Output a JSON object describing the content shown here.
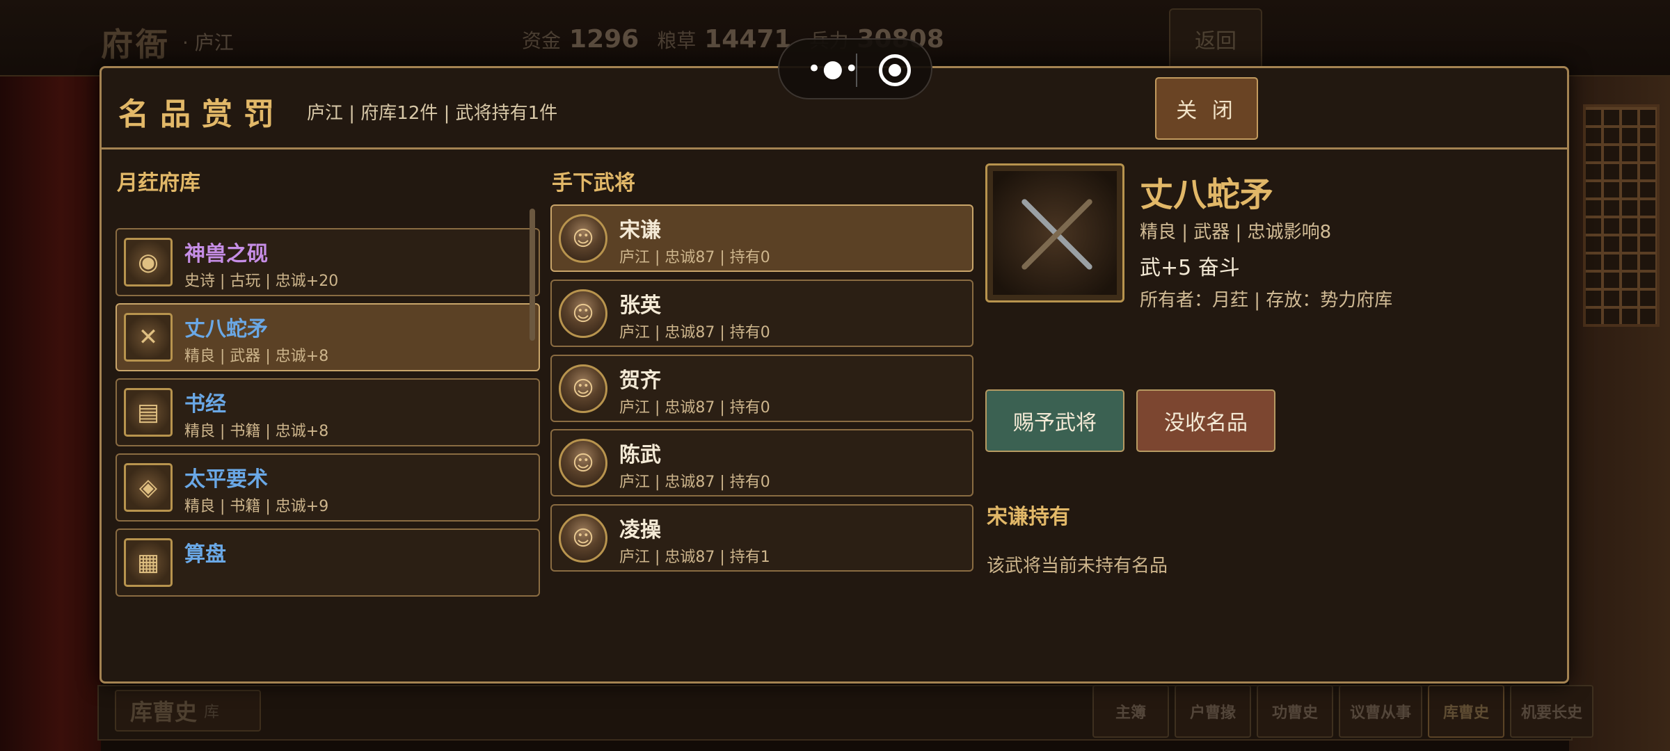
{
  "background": {
    "title": "府衙",
    "subtitle": "· 庐江",
    "resources": [
      {
        "label": "资金",
        "value": "1296"
      },
      {
        "label": "粮草",
        "value": "14471"
      },
      {
        "label": "兵力",
        "value": "30808"
      }
    ],
    "back_label": "返回",
    "bottom_tab": {
      "title": "库曹史",
      "sub": "库"
    },
    "tabs": [
      "主簿",
      "户曹掾",
      "功曹史",
      "议曹从事",
      "库曹史",
      "机要长史"
    ]
  },
  "modal": {
    "title": "名品赏罚",
    "summary": "庐江 | 府库12件 | 武将持有1件",
    "close_label": "关 闭"
  },
  "treasury": {
    "title": "月荭府库",
    "items": [
      {
        "name": "神兽之砚",
        "meta": "史诗 | 古玩 | 忠诚+20",
        "icon": "inkstone-icon",
        "glyph": "◉",
        "rarity": "epic"
      },
      {
        "name": "丈八蛇矛",
        "meta": "精良 | 武器 | 忠诚+8",
        "icon": "spear-icon",
        "glyph": "✕",
        "rarity": "fine"
      },
      {
        "name": "书经",
        "meta": "精良 | 书籍 | 忠诚+8",
        "icon": "book-icon",
        "glyph": "▤",
        "rarity": "fine"
      },
      {
        "name": "太平要术",
        "meta": "精良 | 书籍 | 忠诚+9",
        "icon": "scroll-book-icon",
        "glyph": "◈",
        "rarity": "fine"
      },
      {
        "name": "算盘",
        "meta": "",
        "icon": "abacus-icon",
        "glyph": "▦",
        "rarity": "fine"
      }
    ]
  },
  "generals": {
    "title": "手下武将",
    "items": [
      {
        "name": "宋谦",
        "meta": "庐江 | 忠诚87 | 持有0",
        "icon": "general-portrait-icon"
      },
      {
        "name": "张英",
        "meta": "庐江 | 忠诚87 | 持有0",
        "icon": "general-portrait-icon"
      },
      {
        "name": "贺齐",
        "meta": "庐江 | 忠诚87 | 持有0",
        "icon": "general-portrait-icon"
      },
      {
        "name": "陈武",
        "meta": "庐江 | 忠诚87 | 持有0",
        "icon": "general-portrait-icon"
      },
      {
        "name": "凌操",
        "meta": "庐江 | 忠诚87 | 持有1",
        "icon": "general-portrait-icon"
      }
    ]
  },
  "detail": {
    "name": "丈八蛇矛",
    "line1": "精良 | 武器 | 忠诚影响8",
    "effect": "武+5 奋斗",
    "owner": "所有者：月荭 | 存放：势力府库",
    "grant_label": "赐予武将",
    "confiscate_label": "没收名品",
    "holding_title": "宋谦持有",
    "holding_empty": "该武将当前未持有名品",
    "image_icon": "serpent-spear-icon"
  },
  "colors": {
    "accent_gold": "#e2b868",
    "epic_purple": "#c68ee6",
    "fine_blue": "#6aa8e6",
    "grant_green": "#3b6152",
    "confiscate_red": "#7c4630"
  }
}
